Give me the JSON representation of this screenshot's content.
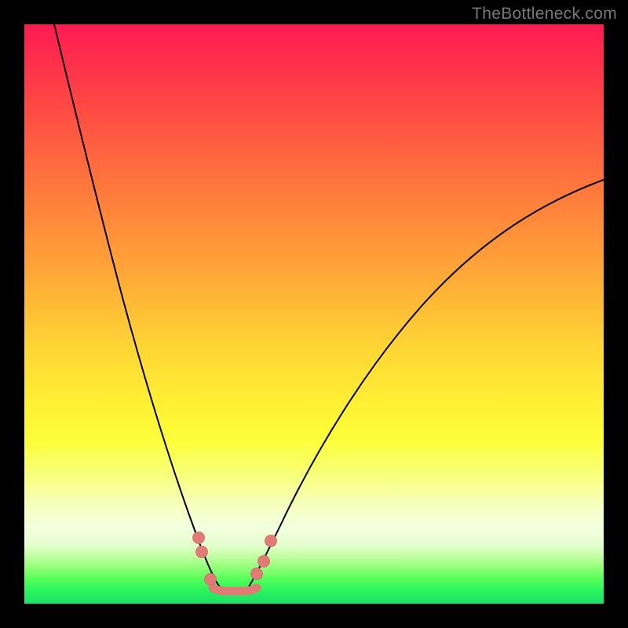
{
  "watermark": "TheBottleneck.com",
  "colors": {
    "curve": "#000000",
    "marker_fill": "#e17b78",
    "marker_stroke": "#d46865"
  },
  "chart_data": {
    "type": "line",
    "title": "",
    "xlabel": "",
    "ylabel": "",
    "xlim": [
      0,
      100
    ],
    "ylim": [
      0,
      100
    ],
    "grid": false,
    "legend": false,
    "note": "No numeric axis ticks are rendered in the image; x positions are inferred as percent of plot width and values are read as percent of plot height from the bottom.",
    "series": [
      {
        "name": "left-branch",
        "x": [
          5,
          7,
          9,
          11,
          13,
          15,
          17,
          19,
          21,
          23,
          25,
          27,
          28,
          29,
          30,
          31,
          32,
          33,
          34
        ],
        "values": [
          100,
          92,
          85,
          78,
          71,
          64,
          57,
          50,
          43,
          36,
          29,
          22,
          18,
          14,
          10,
          7,
          5,
          3,
          2
        ]
      },
      {
        "name": "right-branch",
        "x": [
          38,
          40,
          42,
          45,
          48,
          52,
          56,
          60,
          65,
          70,
          75,
          80,
          85,
          90,
          95,
          100
        ],
        "values": [
          2,
          4,
          7,
          11,
          16,
          22,
          29,
          35,
          42,
          49,
          55,
          60,
          64,
          68,
          71,
          73
        ]
      }
    ],
    "markers": {
      "comment": "pink bead markers near the valley on both branches plus the flat bottom segment",
      "points": [
        {
          "x": 30.0,
          "y": 11.5
        },
        {
          "x": 30.5,
          "y": 9.0
        },
        {
          "x": 32.0,
          "y": 4.3
        },
        {
          "x": 40.0,
          "y": 5.2
        },
        {
          "x": 41.2,
          "y": 7.3
        },
        {
          "x": 42.5,
          "y": 10.8
        }
      ],
      "bottom_segment": {
        "x0": 32.5,
        "x1": 39.2,
        "y": 2.7
      }
    }
  }
}
